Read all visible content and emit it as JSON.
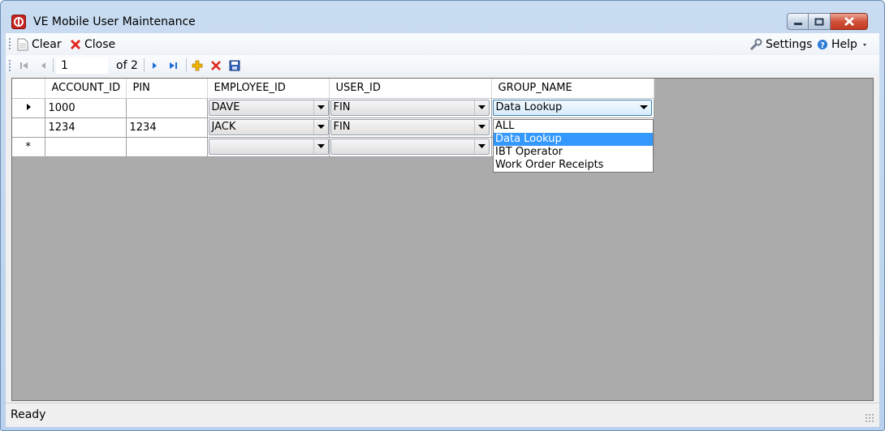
{
  "window": {
    "title": "VE Mobile User Maintenance"
  },
  "menubar": {
    "clear_label": "Clear",
    "close_label": "Close",
    "settings_label": "Settings",
    "help_label": "Help"
  },
  "navigator": {
    "position": "1",
    "of_label": "of 2"
  },
  "grid": {
    "columns": [
      "ACCOUNT_ID",
      "PIN",
      "EMPLOYEE_ID",
      "USER_ID",
      "GROUP_NAME"
    ],
    "rows": [
      {
        "account_id": "1000",
        "pin": "",
        "employee_id": "DAVE",
        "user_id": "FIN",
        "group_name": "Data Lookup"
      },
      {
        "account_id": "1234",
        "pin": "1234",
        "employee_id": "JACK",
        "user_id": "FIN",
        "group_name": ""
      }
    ],
    "new_row_marker": "*"
  },
  "dropdown": {
    "options": [
      "ALL",
      "Data Lookup",
      "IBT Operator",
      "Work Order Receipts"
    ],
    "selected": "Data Lookup"
  },
  "status": {
    "text": "Ready"
  },
  "colors": {
    "selection": "#3399ff",
    "grid_background": "#ababab",
    "delete_red": "#e0271d",
    "add_yellow": "#f0b400",
    "nav_blue": "#1d6ed8"
  }
}
